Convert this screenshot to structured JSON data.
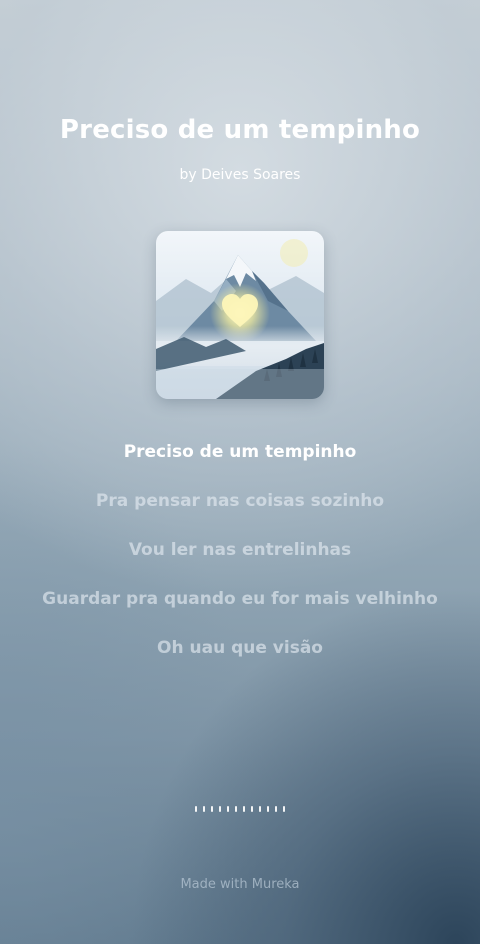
{
  "song": {
    "title": "Preciso de um tempinho",
    "artist": "by Deives Soares"
  },
  "cover": {
    "icon": "mountain-heart-artwork"
  },
  "lyrics": [
    "Preciso de um tempinho",
    "Pra pensar nas coisas sozinho",
    "Vou ler nas entrelinhas",
    "Guardar pra quando eu for mais velhinho",
    "Oh uau que visão"
  ],
  "footer": "Made with Mureka"
}
